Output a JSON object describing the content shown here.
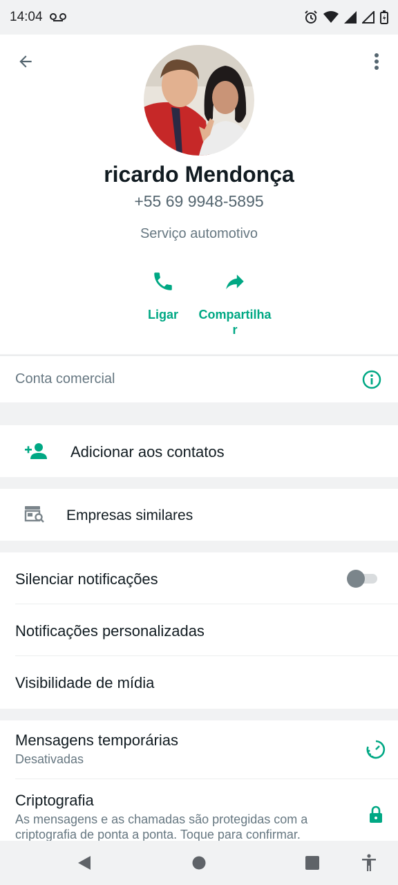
{
  "status_bar": {
    "time": "14:04",
    "icons": [
      "voicemail-icon",
      "alarm-icon",
      "wifi-icon",
      "signal-icon",
      "signal-empty-icon",
      "battery-charging-icon"
    ]
  },
  "header": {
    "name": "ricardo Mendonça",
    "phone": "+55 69 9948-5895",
    "category": "Serviço automotivo",
    "actions": [
      {
        "label": "Ligar",
        "icon": "phone-icon"
      },
      {
        "label": "Compartilhar",
        "icon": "share-icon"
      }
    ]
  },
  "business": {
    "label": "Conta comercial",
    "icon": "info-icon"
  },
  "add_contact": {
    "label": "Adicionar aos contatos",
    "icon": "add-person-icon"
  },
  "similar": {
    "label": "Empresas similares",
    "icon": "store-search-icon"
  },
  "notifications": {
    "mute_label": "Silenciar notificações",
    "mute_enabled": false,
    "custom_label": "Notificações personalizadas",
    "media_label": "Visibilidade de mídia"
  },
  "privacy": {
    "disappearing_label": "Mensagens temporárias",
    "disappearing_value": "Desativadas",
    "encryption_label": "Criptografia",
    "encryption_desc_line1": "As mensagens e as chamadas são protegidas com a",
    "encryption_desc_line2": "criptografia de ponta a ponta. Toque para confirmar."
  },
  "colors": {
    "accent": "#00a884",
    "text_primary": "#111b21",
    "text_secondary": "#667781",
    "background": "#f1f2f3"
  }
}
